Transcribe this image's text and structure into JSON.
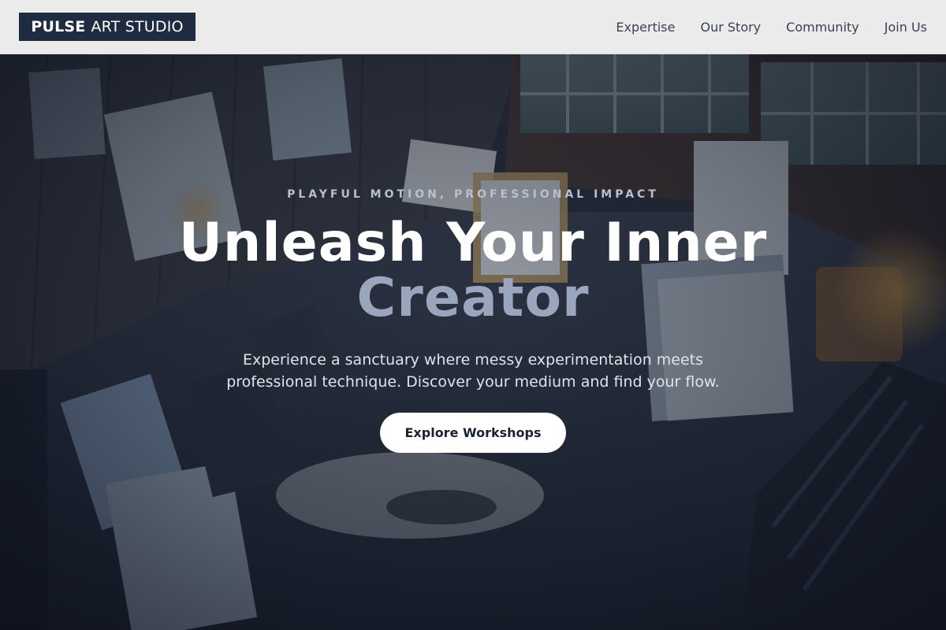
{
  "brand": {
    "bold": "PULSE",
    "light": "ART STUDIO"
  },
  "nav": [
    {
      "label": "Expertise"
    },
    {
      "label": "Our Story"
    },
    {
      "label": "Community"
    },
    {
      "label": "Join Us"
    }
  ],
  "hero": {
    "eyebrow": "PLAYFUL MOTION, PROFESSIONAL IMPACT",
    "headline_line1": "Unleash Your Inner",
    "headline_line2": "Creator",
    "subtitle_line1": "Experience a sanctuary where messy experimentation meets",
    "subtitle_line2": "professional technique. Discover your medium and find your flow.",
    "cta_label": "Explore Workshops"
  },
  "colors": {
    "header_bg": "#ebebec",
    "logo_bg": "#1f2b40",
    "headline_accent": "#9aa6bd",
    "cta_bg": "#ffffff"
  },
  "icons": {
    "background": "art-studio-photo"
  }
}
